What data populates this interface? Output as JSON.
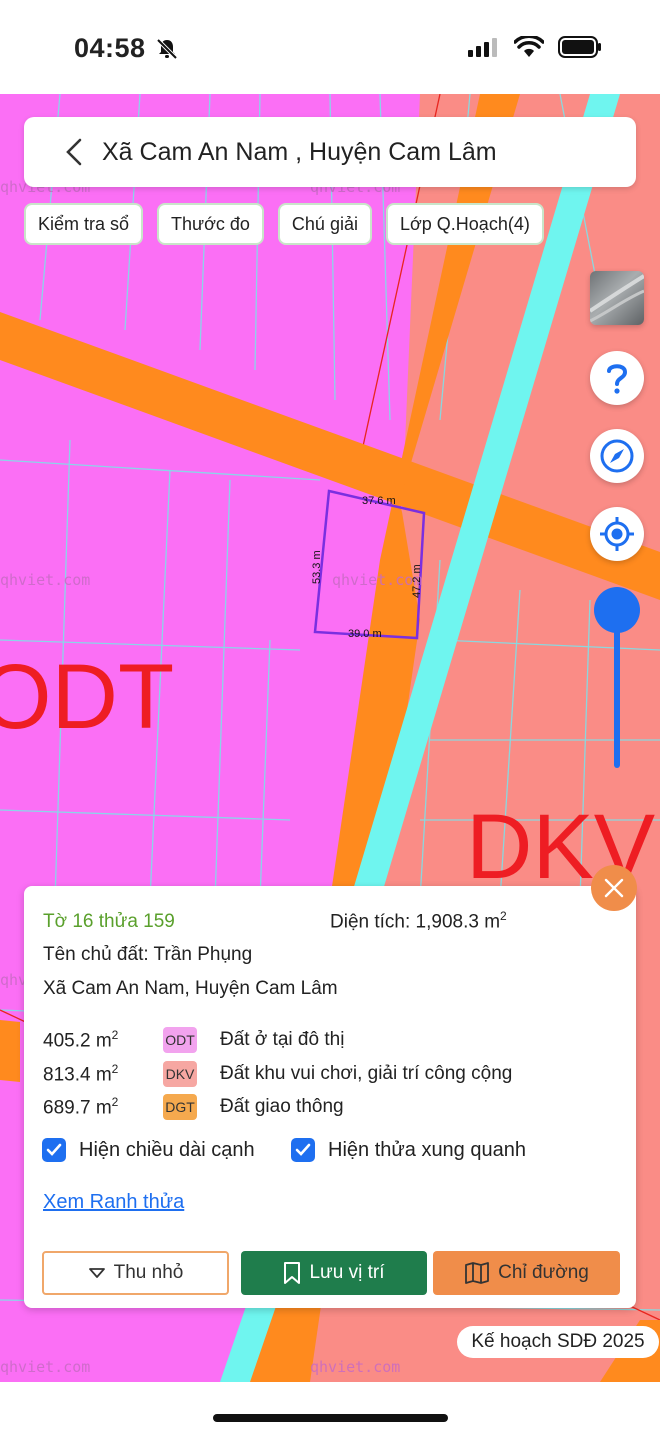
{
  "status": {
    "time": "04:58"
  },
  "search": {
    "title": "Xã Cam An Nam , Huyện Cam Lâm"
  },
  "chips": [
    "Kiểm tra sổ",
    "Thước đo",
    "Chú giải",
    "Lớp Q.Hoạch(4)"
  ],
  "map": {
    "zone_labels": {
      "odt": "ODT",
      "dkv": "DKV"
    },
    "watermark": "qhviet.com",
    "edges": {
      "top": "37.6 m",
      "left": "53.3 m",
      "right": "47.2 m",
      "bottom": "39.0 m"
    },
    "zoom_level": 1.0,
    "colors": {
      "odt": "#fb6ff5",
      "dkv": "#fa8c86",
      "dgt": "#ff8a1e",
      "water": "#6ff5ef",
      "boundary": "#7a2fe0"
    }
  },
  "panel": {
    "parcel_id": "Tờ 16 thửa 159",
    "area_label": "Diện tích: 1,908.3 m",
    "area_sup": "2",
    "owner": "Tên chủ đất: Trần Phụng",
    "address": "Xã Cam An Nam, Huyện Cam Lâm",
    "land_uses": [
      {
        "area": "405.2 m",
        "sup": "2",
        "code": "ODT",
        "name": "Đất ở tại đô thị",
        "color": "#f2a3ee"
      },
      {
        "area": "813.4 m",
        "sup": "2",
        "code": "DKV",
        "name": "Đất khu vui chơi, giải trí công cộng",
        "color": "#f6a7a2"
      },
      {
        "area": "689.7 m",
        "sup": "2",
        "code": "DGT",
        "name": "Đất giao thông",
        "color": "#f5a94e"
      }
    ],
    "check_edges": "Hiện chiều dài cạnh",
    "check_neighbors": "Hiện thửa xung quanh",
    "link": "Xem Ranh thửa",
    "btn_collapse": "Thu nhỏ",
    "btn_save": "Lưu vị trí",
    "btn_directions": "Chỉ đường"
  },
  "plan_badge": "Kế hoạch SDĐ 2025"
}
